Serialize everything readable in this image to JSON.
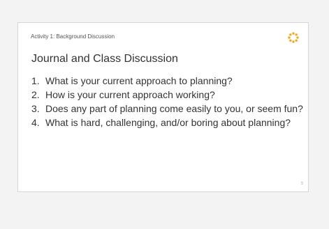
{
  "slide": {
    "activity_label": "Activity 1: Background Discussion",
    "title": "Journal and Class Discussion",
    "questions": [
      {
        "number": "1.",
        "text": "What is your current approach to planning?"
      },
      {
        "number": "2.",
        "text": "How is your current approach working?"
      },
      {
        "number": "3.",
        "text": "Does any part of planning come easily to you, or seem fun?"
      },
      {
        "number": "4.",
        "text": "What is hard, challenging, and/or boring about planning?"
      }
    ],
    "page_number": "5",
    "logo_icon": "dotted-circle-logo-icon"
  },
  "colors": {
    "background": "#f3f3f3",
    "slide_background": "#ffffff",
    "text": "#333333",
    "logo_orange": "#f7a81b"
  }
}
